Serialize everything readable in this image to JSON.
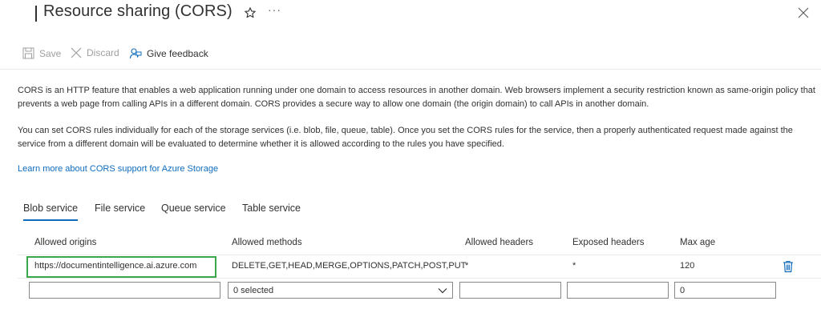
{
  "header": {
    "title": "Resource sharing (CORS)",
    "icons": {
      "favorite": "star-icon",
      "more": "more-icon",
      "close": "close-icon"
    }
  },
  "toolbar": {
    "save_label": "Save",
    "discard_label": "Discard",
    "feedback_label": "Give feedback"
  },
  "description": {
    "paragraph1": "CORS is an HTTP feature that enables a web application running under one domain to access resources in another domain. Web browsers implement a security restriction known as same-origin policy that prevents a web page from calling APIs in a different domain. CORS provides a secure way to allow one domain (the origin domain) to call APIs in another domain.",
    "paragraph2": "You can set CORS rules individually for each of the storage services (i.e. blob, file, queue, table). Once you set the CORS rules for the service, then a properly authenticated request made against the service from a different domain will be evaluated to determine whether it is allowed according to the rules you have specified.",
    "learn_more": "Learn more about CORS support for Azure Storage"
  },
  "tabs": [
    {
      "label": "Blob service",
      "active": true
    },
    {
      "label": "File service",
      "active": false
    },
    {
      "label": "Queue service",
      "active": false
    },
    {
      "label": "Table service",
      "active": false
    }
  ],
  "table": {
    "columns": [
      "Allowed origins",
      "Allowed methods",
      "Allowed headers",
      "Exposed headers",
      "Max age"
    ],
    "rows": [
      {
        "allowed_origins": "https://documentintelligence.ai.azure.com",
        "allowed_methods": "DELETE,GET,HEAD,MERGE,OPTIONS,PATCH,POST,PUT",
        "allowed_headers": "*",
        "exposed_headers": "*",
        "max_age": "120"
      }
    ],
    "new_row": {
      "allowed_origins": "",
      "allowed_methods_selected": "0 selected",
      "allowed_headers": "",
      "exposed_headers": "",
      "max_age": "0"
    }
  },
  "colors": {
    "accent": "#0f6cbd",
    "highlight_border": "#3aa74a",
    "disabled_text": "#a19f9d"
  }
}
